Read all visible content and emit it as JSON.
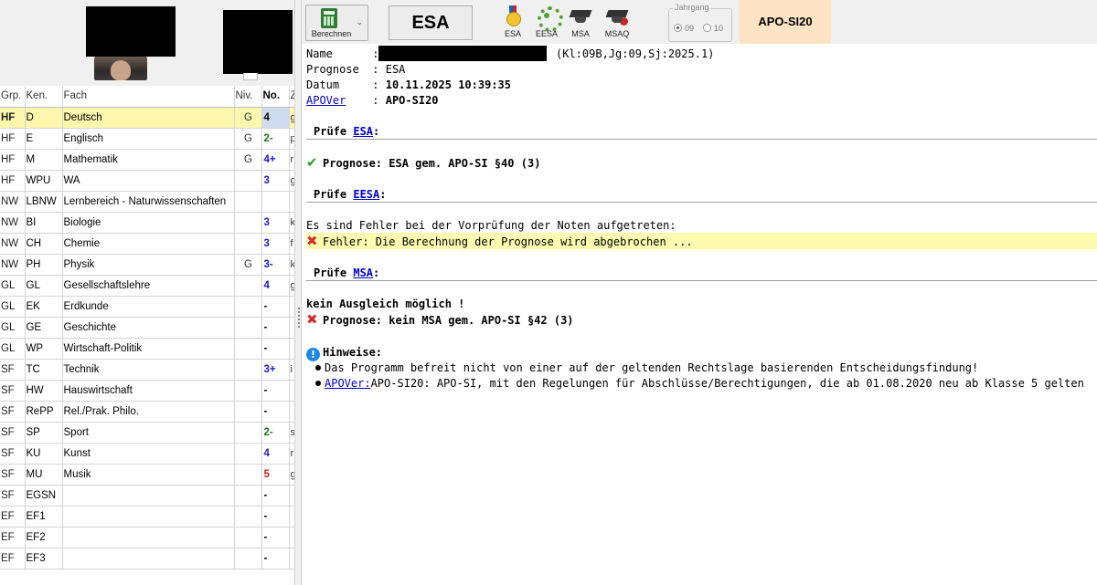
{
  "left": {
    "columns": [
      "Grp.",
      "Ken.",
      "Fach",
      "Niv.",
      "No.",
      "Z"
    ],
    "rows": [
      {
        "grp": "HF",
        "ken": "D",
        "fach": "Deutsch",
        "niv": "G",
        "no": "4",
        "extra": "g",
        "color": "#000000"
      },
      {
        "grp": "HF",
        "ken": "E",
        "fach": "Englisch",
        "niv": "G",
        "no": "2-",
        "extra": "p",
        "color": "#1a7a1a"
      },
      {
        "grp": "HF",
        "ken": "M",
        "fach": "Mathematik",
        "niv": "G",
        "no": "4+",
        "extra": "r",
        "color": "#1a1acc"
      },
      {
        "grp": "HF",
        "ken": "WPU",
        "fach": "WA",
        "niv": "",
        "no": "3",
        "extra": "g",
        "color": "#1a1acc"
      },
      {
        "grp": "NW",
        "ken": "LBNW",
        "fach": "Lernbereich - Naturwissenschaften",
        "niv": "",
        "no": "",
        "extra": "",
        "color": "#000000"
      },
      {
        "grp": "NW",
        "ken": "BI",
        "fach": "Biologie",
        "niv": "",
        "no": "3",
        "extra": "k",
        "color": "#1a1acc"
      },
      {
        "grp": "NW",
        "ken": "CH",
        "fach": "Chemie",
        "niv": "",
        "no": "3",
        "extra": "f",
        "color": "#1a1acc"
      },
      {
        "grp": "NW",
        "ken": "PH",
        "fach": "Physik",
        "niv": "G",
        "no": "3-",
        "extra": "k",
        "color": "#1a1acc"
      },
      {
        "grp": "GL",
        "ken": "GL",
        "fach": "Gesellschaftslehre",
        "niv": "",
        "no": "4",
        "extra": "g",
        "color": "#1a1acc"
      },
      {
        "grp": "GL",
        "ken": "EK",
        "fach": "Erdkunde",
        "niv": "",
        "no": "-",
        "extra": "",
        "color": "#000000"
      },
      {
        "grp": "GL",
        "ken": "GE",
        "fach": "Geschichte",
        "niv": "",
        "no": "-",
        "extra": "",
        "color": "#000000"
      },
      {
        "grp": "GL",
        "ken": "WP",
        "fach": "Wirtschaft-Politik",
        "niv": "",
        "no": "-",
        "extra": "",
        "color": "#000000"
      },
      {
        "grp": "SF",
        "ken": "TC",
        "fach": "Technik",
        "niv": "",
        "no": "3+",
        "extra": "i",
        "color": "#1a1acc"
      },
      {
        "grp": "SF",
        "ken": "HW",
        "fach": "Hauswirtschaft",
        "niv": "",
        "no": "-",
        "extra": "",
        "color": "#000000"
      },
      {
        "grp": "SF",
        "ken": "RePP",
        "fach": "Rel./Prak. Philo.",
        "niv": "",
        "no": "-",
        "extra": "",
        "color": "#000000"
      },
      {
        "grp": "SF",
        "ken": "SP",
        "fach": "Sport",
        "niv": "",
        "no": "2-",
        "extra": "s",
        "color": "#1a7a1a"
      },
      {
        "grp": "SF",
        "ken": "KU",
        "fach": "Kunst",
        "niv": "",
        "no": "4",
        "extra": "r",
        "color": "#1a1acc"
      },
      {
        "grp": "SF",
        "ken": "MU",
        "fach": "Musik",
        "niv": "",
        "no": "5",
        "extra": "g",
        "color": "#d21a1a"
      },
      {
        "grp": "SF",
        "ken": "EGSN",
        "fach": "",
        "niv": "",
        "no": "-",
        "extra": "",
        "color": "#000000"
      },
      {
        "grp": "EF",
        "ken": "EF1",
        "fach": "",
        "niv": "",
        "no": "-",
        "extra": "",
        "color": "#000000"
      },
      {
        "grp": "EF",
        "ken": "EF2",
        "fach": "",
        "niv": "",
        "no": "-",
        "extra": "",
        "color": "#000000"
      },
      {
        "grp": "EF",
        "ken": "EF3",
        "fach": "",
        "niv": "",
        "no": "-",
        "extra": "",
        "color": "#000000"
      }
    ]
  },
  "toolbar": {
    "calc_label": "Berechnen",
    "main_label": "ESA",
    "degrees": [
      "ESA",
      "EESA",
      "MSA",
      "MSAQ"
    ],
    "jahrgang_title": "Jahrgang",
    "jahrgang_options": [
      "09",
      "10"
    ],
    "apo_label": "APO-SI20"
  },
  "report": {
    "name_key": "Name",
    "name_suffix": "(Kl:09B,Jg:09,Sj:2025.1)",
    "prognose_key": "Prognose",
    "prognose_val": "ESA",
    "datum_key": "Datum",
    "datum_val": "10.11.2025 10:39:35",
    "apover_key": "APOVer",
    "apover_val": "APO-SI20",
    "sep": ":",
    "pruefe": "Prüfe",
    "esa": "ESA",
    "eesa": "EESA",
    "msa": "MSA",
    "esa_result": "Prognose: ESA gem. APO-SI §40 (3)",
    "err_intro": "Es sind Fehler bei der Vorprüfung der Noten aufgetreten:",
    "err_line": "Fehler: Die Berechnung der Prognose wird abgebrochen ...",
    "no_ausgleich": "kein Ausgleich möglich !",
    "msa_result": "Prognose: kein MSA gem. APO-SI §42 (3)",
    "hinweise": "Hinweise:",
    "hint1": "Das Programm befreit nicht von einer auf der geltenden Rechtslage basierenden Entscheidungsfindung!",
    "hint2_link": "APOVer:",
    "hint2_text": "APO-SI20: APO-SI, mit den Regelungen für Abschlüsse/Berechtigungen, die ab 01.08.2020 neu ab Klasse 5 gelten"
  },
  "colors": {
    "highlight": "#fdf7ad",
    "apo_bg": "#fbe3c3",
    "link": "#0000cc",
    "grade_blue": "#1a1acc",
    "grade_green": "#1a7a1a",
    "grade_red": "#d21a1a"
  }
}
